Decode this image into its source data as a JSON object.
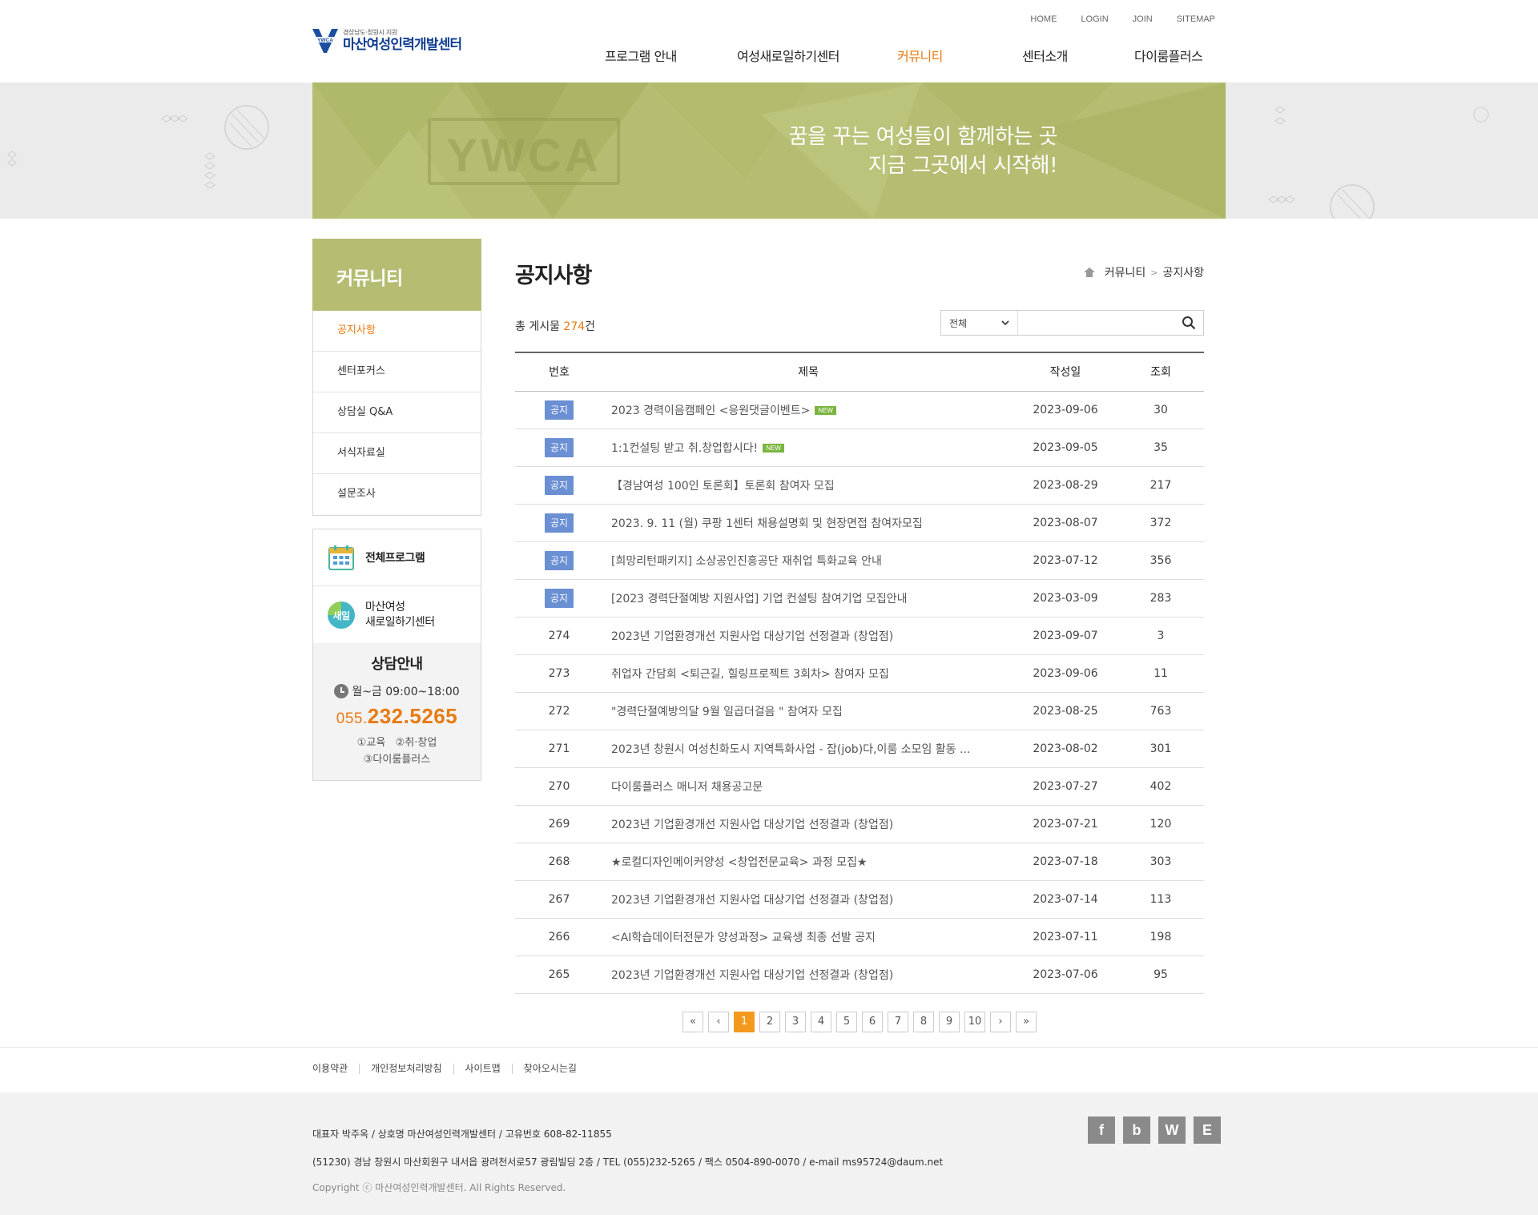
{
  "header": {
    "logo_sub": "경상남도·창원시 지원",
    "logo_name": "마산여성인력개발센터",
    "logo_mark": "YWCA",
    "util": [
      "HOME",
      "LOGIN",
      "JOIN",
      "SITEMAP"
    ],
    "nav": [
      {
        "label": "프로그램 안내",
        "active": false
      },
      {
        "label": "여성새로일하기센터",
        "active": false
      },
      {
        "label": "커뮤니티",
        "active": true
      },
      {
        "label": "센터소개",
        "active": false
      },
      {
        "label": "다이룸플러스",
        "active": false
      }
    ]
  },
  "banner": {
    "line1": "꿈을 꾸는 여성들이 함께하는 곳",
    "line2": "지금 그곳에서 시작해!",
    "watermark": "YWCA"
  },
  "sidebar": {
    "title": "커뮤니티",
    "items": [
      {
        "label": "공지사항",
        "active": true
      },
      {
        "label": "센터포커스",
        "active": false
      },
      {
        "label": "상담실 Q&A",
        "active": false
      },
      {
        "label": "서식자료실",
        "active": false
      },
      {
        "label": "설문조사",
        "active": false
      }
    ],
    "quick": [
      {
        "label": "전체프로그램",
        "icon": "calendar-icon"
      },
      {
        "label": "마산여성\n새로일하기센터",
        "icon": "saeil-icon",
        "line1": "마산여성",
        "line2": "새로일하기센터",
        "icon_text": "새일"
      }
    ],
    "counsel": {
      "title": "상담안내",
      "time": "월~금 09:00~18:00",
      "tel_prefix": "055.",
      "tel_main": "232.5265",
      "opt1": "①교육   ②취·창업",
      "opt2": "③다이룸플러스"
    }
  },
  "content": {
    "title": "공지사항",
    "breadcrumb": [
      "커뮤니티",
      "공지사항"
    ],
    "breadcrumb_sep": ">",
    "total_prefix": "총 게시물 ",
    "total_count": "274",
    "total_suffix": "건",
    "search": {
      "select": "전체",
      "placeholder": ""
    },
    "columns": [
      "번호",
      "제목",
      "작성일",
      "조회"
    ],
    "notice_label": "공지",
    "new_label": "NEW",
    "rows": [
      {
        "no": "공지",
        "notice": true,
        "title": "2023 경력이음캠페인 <응원댓글이벤트>",
        "new": true,
        "date": "2023-09-06",
        "views": "30"
      },
      {
        "no": "공지",
        "notice": true,
        "title": "1:1컨설팅 받고 취.창업합시다!",
        "new": true,
        "date": "2023-09-05",
        "views": "35"
      },
      {
        "no": "공지",
        "notice": true,
        "title": "【경남여성 100인 토론회】토론회 참여자 모집",
        "new": false,
        "date": "2023-08-29",
        "views": "217"
      },
      {
        "no": "공지",
        "notice": true,
        "title": "2023. 9. 11 (월) 쿠팡 1센터 채용설명회 및 현장면접 참여자모집",
        "new": false,
        "date": "2023-08-07",
        "views": "372"
      },
      {
        "no": "공지",
        "notice": true,
        "title": "[희망리턴패키지] 소상공인진흥공단 재취업 특화교육 안내",
        "new": false,
        "date": "2023-07-12",
        "views": "356"
      },
      {
        "no": "공지",
        "notice": true,
        "title": "[2023 경력단절예방 지원사업] 기업 컨설팅 참여기업 모집안내",
        "new": false,
        "date": "2023-03-09",
        "views": "283"
      },
      {
        "no": "274",
        "notice": false,
        "title": "2023년 기업환경개선 지원사업 대상기업 선정결과 (창업점)",
        "new": false,
        "date": "2023-09-07",
        "views": "3"
      },
      {
        "no": "273",
        "notice": false,
        "title": "취업자 간담회 <퇴근길, 힐링프로젝트 3회차> 참여자 모집",
        "new": false,
        "date": "2023-09-06",
        "views": "11"
      },
      {
        "no": "272",
        "notice": false,
        "title": "\"경력단절예방의달 9월 일곱더걸음 \" 참여자 모집",
        "new": false,
        "date": "2023-08-25",
        "views": "763"
      },
      {
        "no": "271",
        "notice": false,
        "title": "2023년 창원시 여성친화도시 지역특화사업 - 잡(job)다,이룸 소모임 활동 ...",
        "new": false,
        "date": "2023-08-02",
        "views": "301"
      },
      {
        "no": "270",
        "notice": false,
        "title": "다이룸플러스 매니저 채용공고문",
        "new": false,
        "date": "2023-07-27",
        "views": "402"
      },
      {
        "no": "269",
        "notice": false,
        "title": "2023년 기업환경개선 지원사업 대상기업 선정결과 (창업점)",
        "new": false,
        "date": "2023-07-21",
        "views": "120"
      },
      {
        "no": "268",
        "notice": false,
        "title": "★로컬디자인메이커양성 <창업전문교육> 과정 모집★",
        "new": false,
        "date": "2023-07-18",
        "views": "303"
      },
      {
        "no": "267",
        "notice": false,
        "title": "2023년 기업환경개선 지원사업 대상기업 선정결과 (창업점)",
        "new": false,
        "date": "2023-07-14",
        "views": "113"
      },
      {
        "no": "266",
        "notice": false,
        "title": "<AI학습데이터전문가 양성과정> 교육생 최종 선발 공지",
        "new": false,
        "date": "2023-07-11",
        "views": "198"
      },
      {
        "no": "265",
        "notice": false,
        "title": "2023년 기업환경개선 지원사업 대상기업 선정결과 (창업점)",
        "new": false,
        "date": "2023-07-06",
        "views": "95"
      }
    ],
    "paging": {
      "first": "«",
      "prev": "‹",
      "pages": [
        "1",
        "2",
        "3",
        "4",
        "5",
        "6",
        "7",
        "8",
        "9",
        "10"
      ],
      "current": "1",
      "next": "›",
      "last": "»"
    }
  },
  "footer": {
    "links": [
      "이용약관",
      "개인정보처리방침",
      "사이트맵",
      "찾아오시는길"
    ],
    "info1": "대표자 박주옥 / 상호명 마산여성인력개발센터 / 고유번호 608-82-11855",
    "info2": "(51230) 경남 창원시 마산회원구 내서읍 광려천서로57 광림빌딩 2층 / TEL (055)232-5265 / 팩스 0504-890-0070 / e-mail ms95724@daum.net",
    "copyright": "Copyright ⓒ 마산여성인력개발센터. All Rights Reserved.",
    "sns": [
      {
        "label": "f",
        "icon": "facebook-icon"
      },
      {
        "label": "b",
        "icon": "blog-icon"
      },
      {
        "label": "W",
        "icon": "w-icon"
      },
      {
        "label": "E",
        "icon": "e-icon"
      }
    ]
  },
  "colors": {
    "accent": "#e87a10",
    "banner": "#b6bd72",
    "notice_badge": "#6a8fd3",
    "new_badge": "#7ab53f",
    "page_active": "#f39a1e"
  }
}
